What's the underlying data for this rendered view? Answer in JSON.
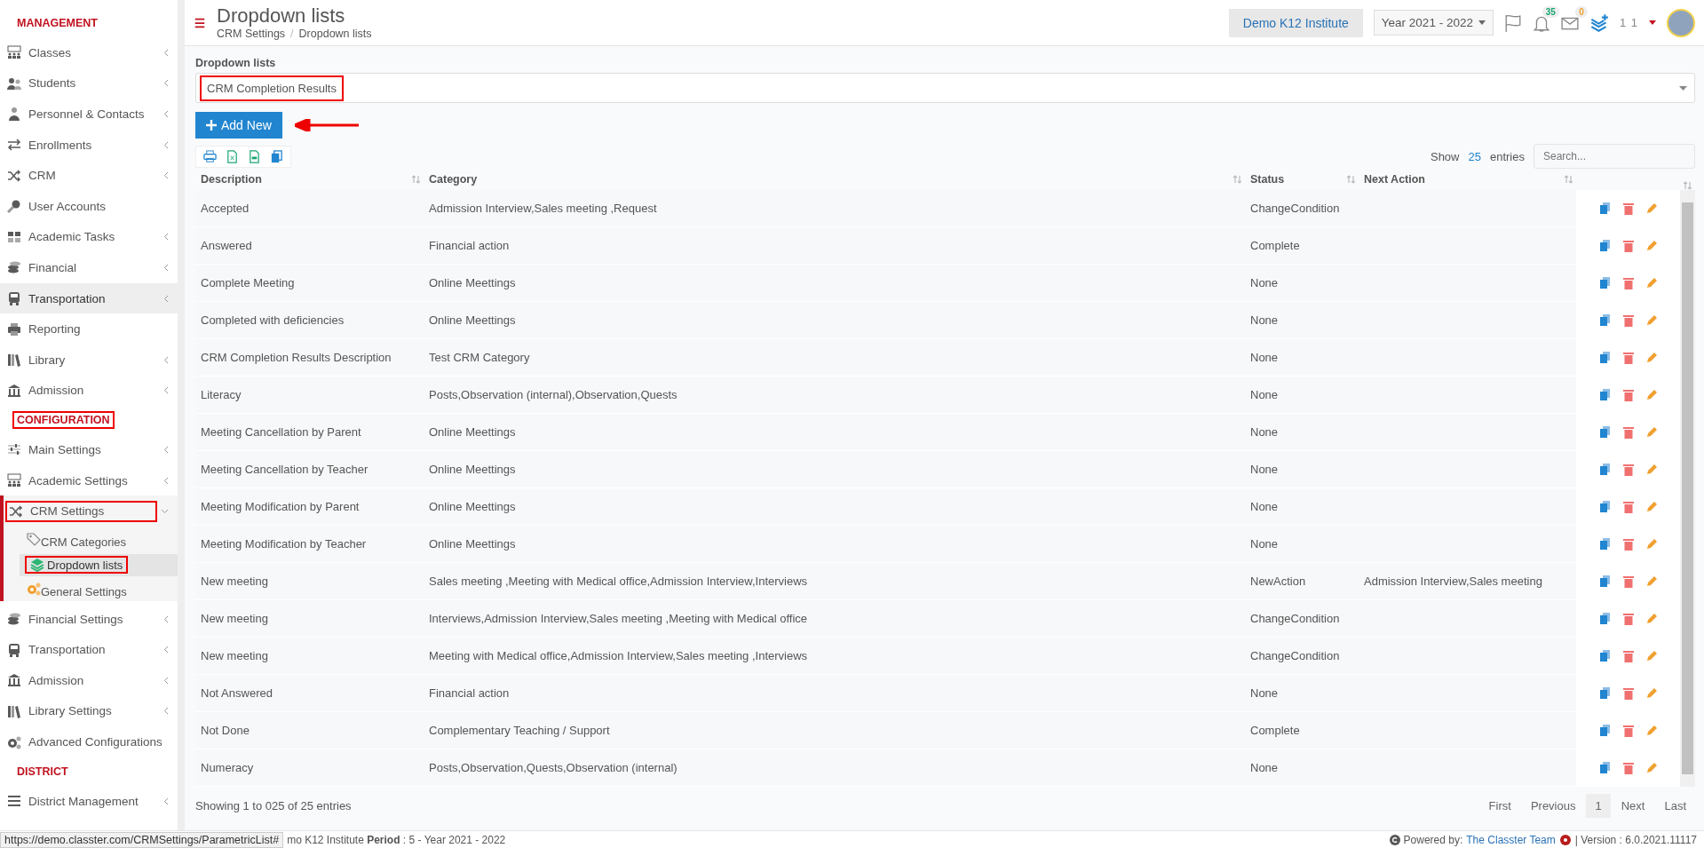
{
  "sidebar": {
    "sections": [
      {
        "heading": "MANAGEMENT",
        "highlighted": false,
        "items": [
          {
            "label": "Classes",
            "has_submenu": true,
            "expanded": false,
            "selected": false,
            "hovered": false,
            "highlighted": false
          },
          {
            "label": "Students",
            "has_submenu": true,
            "expanded": false,
            "selected": false,
            "hovered": false,
            "highlighted": false
          },
          {
            "label": "Personnel & Contacts",
            "has_submenu": true,
            "expanded": false,
            "selected": false,
            "hovered": false,
            "highlighted": false
          },
          {
            "label": "Enrollments",
            "has_submenu": true,
            "expanded": false,
            "selected": false,
            "hovered": false,
            "highlighted": false
          },
          {
            "label": "CRM",
            "has_submenu": true,
            "expanded": false,
            "selected": false,
            "hovered": false,
            "highlighted": false
          },
          {
            "label": "User Accounts",
            "has_submenu": false,
            "selected": false,
            "hovered": false,
            "highlighted": false
          },
          {
            "label": "Academic Tasks",
            "has_submenu": true,
            "expanded": false,
            "selected": false,
            "hovered": false,
            "highlighted": false
          },
          {
            "label": "Financial",
            "has_submenu": true,
            "expanded": false,
            "selected": false,
            "hovered": false,
            "highlighted": false
          },
          {
            "label": "Transportation",
            "has_submenu": true,
            "expanded": false,
            "selected": false,
            "hovered": true,
            "highlighted": false
          },
          {
            "label": "Reporting",
            "has_submenu": false,
            "selected": false,
            "hovered": false,
            "highlighted": false
          },
          {
            "label": "Library",
            "has_submenu": true,
            "expanded": false,
            "selected": false,
            "hovered": false,
            "highlighted": false
          },
          {
            "label": "Admission",
            "has_submenu": true,
            "expanded": false,
            "selected": false,
            "hovered": false,
            "highlighted": false
          }
        ]
      },
      {
        "heading": "CONFIGURATION",
        "highlighted": true,
        "items": [
          {
            "label": "Main Settings",
            "has_submenu": true,
            "expanded": false,
            "selected": false,
            "hovered": false,
            "highlighted": false
          },
          {
            "label": "Academic Settings",
            "has_submenu": true,
            "expanded": false,
            "selected": false,
            "hovered": false,
            "highlighted": false
          },
          {
            "label": "CRM Settings",
            "has_submenu": true,
            "expanded": true,
            "selected": false,
            "hovered": false,
            "highlighted": true,
            "children": [
              {
                "label": "CRM Categories",
                "selected": false,
                "highlighted": false
              },
              {
                "label": "Dropdown lists",
                "selected": true,
                "highlighted": true
              },
              {
                "label": "General Settings",
                "selected": false,
                "highlighted": false
              }
            ]
          },
          {
            "label": "Financial Settings",
            "has_submenu": true,
            "expanded": false,
            "selected": false,
            "hovered": false,
            "highlighted": false
          },
          {
            "label": "Transportation",
            "has_submenu": true,
            "expanded": false,
            "selected": false,
            "hovered": false,
            "highlighted": false
          },
          {
            "label": "Admission",
            "has_submenu": true,
            "expanded": false,
            "selected": false,
            "hovered": false,
            "highlighted": false
          },
          {
            "label": "Library Settings",
            "has_submenu": true,
            "expanded": false,
            "selected": false,
            "hovered": false,
            "highlighted": false
          },
          {
            "label": "Advanced Configurations",
            "has_submenu": false,
            "selected": false,
            "hovered": false,
            "highlighted": false
          }
        ]
      },
      {
        "heading": "DISTRICT",
        "highlighted": false,
        "items": [
          {
            "label": "District Management",
            "has_submenu": true,
            "expanded": false,
            "selected": false,
            "hovered": false,
            "highlighted": false
          }
        ]
      }
    ]
  },
  "header": {
    "title": "Dropdown lists",
    "breadcrumb": [
      "CRM Settings",
      "Dropdown lists"
    ],
    "breadcrumb_separator": "/",
    "institute": "Demo K12 Institute",
    "year": "Year 2021 - 2022",
    "notifications": "35",
    "messages": "0",
    "user": "1 1"
  },
  "form": {
    "label": "Dropdown lists",
    "select": {
      "value": "CRM Completion Results",
      "highlighted": true
    },
    "add_button": "Add New"
  },
  "table": {
    "show": "Show",
    "page_size": "25",
    "entries": "entries",
    "search": {
      "placeholder": "Search..."
    },
    "columns": [
      "Description",
      "Category",
      "Status",
      "Next Action"
    ],
    "rows": [
      [
        "Accepted",
        "Admission Interview,Sales meeting ,Request",
        "ChangeCondition",
        ""
      ],
      [
        "Answered",
        "Financial action",
        "Complete",
        ""
      ],
      [
        "Complete Meeting",
        "Online Meettings",
        "None",
        ""
      ],
      [
        "Completed with deficiencies",
        "Online Meettings",
        "None",
        ""
      ],
      [
        "CRM Completion Results Description",
        "Test CRM Category",
        "None",
        ""
      ],
      [
        "Literacy",
        "Posts,Observation (internal),Observation,Quests",
        "None",
        ""
      ],
      [
        "Meeting Cancellation by Parent",
        "Online Meettings",
        "None",
        ""
      ],
      [
        "Meeting Cancellation by Teacher",
        "Online Meettings",
        "None",
        ""
      ],
      [
        "Meeting Modification by Parent",
        "Online Meettings",
        "None",
        ""
      ],
      [
        "Meeting Modification by Teacher",
        "Online Meettings",
        "None",
        ""
      ],
      [
        "New meeting",
        "Sales meeting ,Meeting with Medical office,Admission Interview,Interviews",
        "NewAction",
        "Admission Interview,Sales meeting"
      ],
      [
        "New meeting",
        "Interviews,Admission Interview,Sales meeting ,Meeting with Medical office",
        "ChangeCondition",
        ""
      ],
      [
        "New meeting",
        "Meeting with Medical office,Admission Interview,Sales meeting ,Interviews",
        "ChangeCondition",
        ""
      ],
      [
        "Not Answered",
        "Financial action",
        "None",
        ""
      ],
      [
        "Not Done",
        "Complementary Teaching / Support",
        "Complete",
        ""
      ],
      [
        "Numeracy",
        "Posts,Observation,Quests,Observation (internal)",
        "None",
        ""
      ]
    ],
    "info": "Showing 1 to 025 of 25 entries",
    "pagination": [
      {
        "label": "First",
        "selected": false
      },
      {
        "label": "Previous",
        "selected": false
      },
      {
        "label": "1",
        "selected": true
      },
      {
        "label": "Next",
        "selected": false
      },
      {
        "label": "Last",
        "selected": false
      }
    ]
  },
  "status_url": "https://demo.classter.com/CRMSettings/ParametricList#",
  "footer": {
    "left": "mo K12 Institute **Period** : 5 - Year 2021 - 2022",
    "powered": "Powered by:",
    "team": "The Classter Team",
    "version": "| Version : 6.0.2021.11117"
  }
}
